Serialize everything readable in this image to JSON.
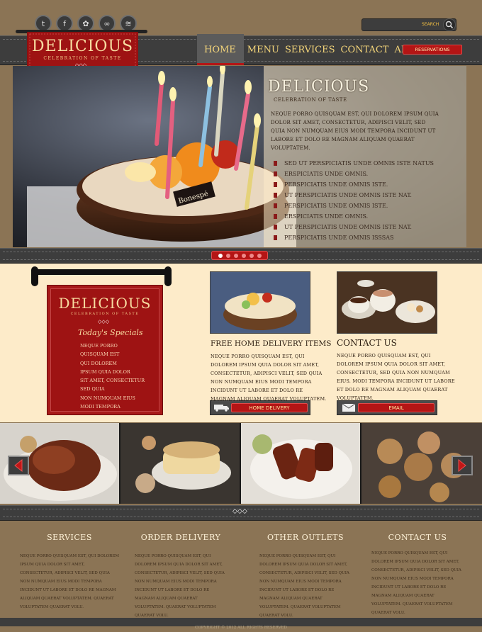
{
  "social": [
    "twitter-icon",
    "facebook-icon",
    "dribbble-icon",
    "flickr-icon",
    "rss-icon"
  ],
  "social_glyphs": [
    "t",
    "f",
    "✿",
    "∞",
    "≋"
  ],
  "search": {
    "label": "SEARCH",
    "placeholder": ""
  },
  "logo": {
    "title": "DELICIOUS",
    "subtitle": "CELEBRATION OF TASTE"
  },
  "nav": {
    "items": [
      "HOME",
      "MENU",
      "SERVICES",
      "CONTACT",
      "ABOUT"
    ],
    "reservations": "RESERVATIONS"
  },
  "hero": {
    "title": "DELICIOUS",
    "subtitle": "CELEBRATION OF TASTE",
    "intro": "NEQUE PORRO QUISQUAM EST, QUI DOLOREM IPSUM QUIA DOLOR SIT AMET, CONSECTETUR, ADIPISCI VELIT, SED QUIA NON NUMQUAM EIUS MODI TEMPORA INCIDUNT UT LABORE ET DOLO RE MAGNAM ALIQUAM QUAERAT VOLUPTATEM.",
    "bullets": [
      "SED UT PERSPICIATIS UNDE OMNIS ISTE NATUS",
      "ERSPICIATIS UNDE OMNIS.",
      "PERSPICIATIS UNDE OMNIS ISTE.",
      "UT PERSPICIATIS UNDE OMNIS ISTE NAT.",
      "PERSPICIATIS UNDE OMNIS ISTE.",
      "ERSPICIATIS UNDE OMNIS.",
      "UT PERSPICIATIS UNDE OMNIS ISTE NAT.",
      "PERSPICIATIS UNDE OMNIS ISSSAS"
    ],
    "cake_label": "Bonespé"
  },
  "specials": {
    "title": "DELICIOUS",
    "subtitle": "CELEBRATION OF TASTE",
    "heading": "Today's Specials",
    "items": [
      "NEQUE PORRO",
      "QUISQUAM EST",
      "QUI DOLOREM",
      "IPSUM QUIA DOLOR",
      "SIT AMET, CONSECTETUR",
      "SED QUIA",
      "NON NUMQUAM EIUS",
      "MODI TEMPORA"
    ]
  },
  "delivery": {
    "title": "FREE HOME DELIVERY ITEMS",
    "text": "NEQUE PORRO QUISQUAM EST, QUI DOLOREM IPSUM QUIA DOLOR SIT AMET, CONSECTETUR, ADIPISCI VELIT, SED QUIA NON NUMQUAM EIUS MODI TEMPORA INCIDUNT UT LABORE ET DOLO RE MAGNAM ALIQUAM QUAERAT VOLUPTATEM.",
    "button": "HOME DELIVERY"
  },
  "contact": {
    "title": "CONTACT US",
    "text": "NEQUE PORRO QUISQUAM EST, QUI DOLOREM IPSUM QUIA DOLOR SIT AMET, CONSECTETUR, SED QUIA NON NUMQUAM EIUS. MODI TEMPORA INCIDUNT UT LABORE ET DOLO RE MAGNAM ALIQUAM QUAERAT VOLUPTATEM.",
    "button": "EMAIL"
  },
  "footer": {
    "columns": [
      {
        "title": "SERVICES",
        "text": "NEQUE PORRO QUISQUAM EST, QUI DOLOREM IPSUM QUIA DOLOR SIT AMET, CONSECTETUR, ADIPISCI VELIT, SED QUIA NON NUMQUAM EIUS MODI TEMPORA INCIDUNT UT LABORE ET DOLO RE MAGNAM ALIQUAM QUAERAT VOLUPTATEM. QUAERAT VOLUPTATEM QUAERAT VOLU."
      },
      {
        "title": "ORDER DELIVERY",
        "text": "NEQUE PORRO QUISQUAM EST, QUI DOLOREM IPSUM QUIA DOLOR SIT AMET, CONSECTETUR, ADIPISCI VELIT, SED QUIA NON NUMQUAM EIUS MODI TEMPORA INCIDUNT UT LABORE ET DOLO RE MAGNAM ALIQUAM QUAERAT VOLUPTATEM. QUAERAT VOLUPTATEM QUAERAT VOLU."
      },
      {
        "title": "OTHER OUTLETS",
        "text": "NEQUE PORRO QUISQUAM EST, QUI DOLOREM IPSUM QUIA DOLOR SIT AMET, CONSECTETUR, ADIPISCI VELIT, SED QUIA NON NUMQUAM EIUS MODI TEMPORA INCIDUNT UT LABORE ET DOLO RE MAGNAM ALIQUAM QUAERAT VOLUPTATEM. QUAERAT VOLUPTATEM QUAERAT VOLU."
      },
      {
        "title": "CONTACT US",
        "text": "NEQUE PORRO QUISQUAM EST, QUI DOLOREM IPSUM QUIA DOLOR SIT AMET, CONSECTETUR, ADIPISCI VELIT, SED QUIA NON NUMQUAM EIUS MODI TEMPORA INCIDUNT UT LABORE ET DOLO RE MAGNAM ALIQUAM QUAERAT VOLUPTATEM. QUAERAT VOLUPTATEM QUAERAT VOLU."
      }
    ],
    "copyright": "COPYRIGHT © 2012 ALL RIGHTS RESERVED"
  },
  "colors": {
    "accent": "#b41515",
    "gold": "#f5d67a",
    "bar": "#3d3d3d",
    "cream": "#fdebc9",
    "tan": "#8b7455"
  }
}
